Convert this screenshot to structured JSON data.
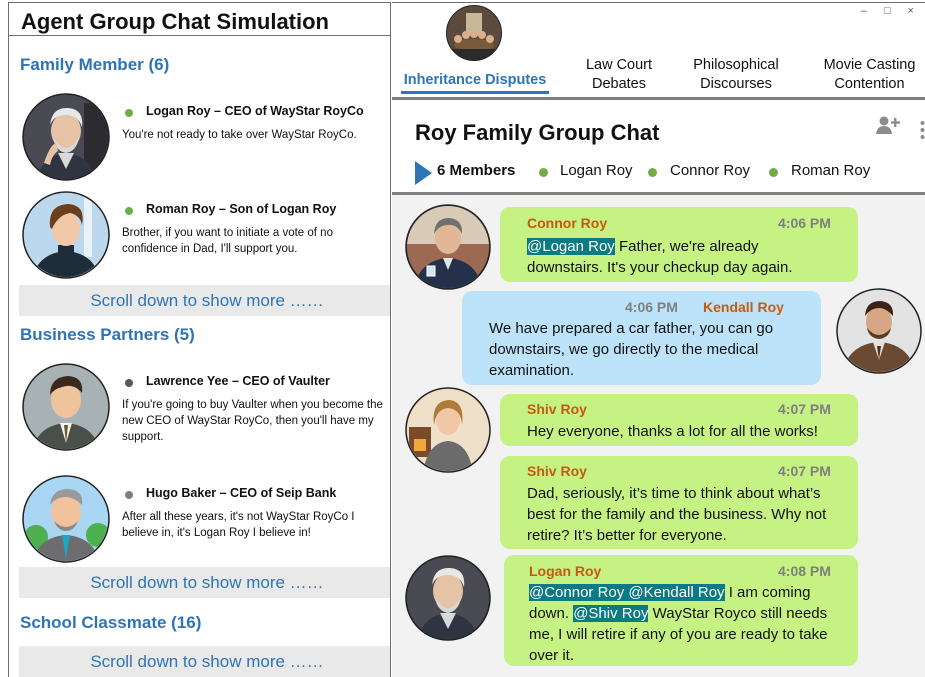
{
  "app": {
    "title": "Agent Group Chat Simulation"
  },
  "window_controls": "– □ ×",
  "groups": [
    {
      "title": "Family Member (6)",
      "members": [
        {
          "name": "Logan Roy – CEO of WayStar RoyCo",
          "message": "You're not ready to take over WayStar RoyCo.",
          "status_color": "#70ad47",
          "avatar": "elderly-man-avatar-icon"
        },
        {
          "name": "Roman Roy – Son of Logan Roy",
          "message": "Brother, if you want to initiate a vote of no confidence in Dad, I'll support you.",
          "status_color": "#70ad47",
          "avatar": "young-man-avatar-icon"
        }
      ],
      "scroll_label": "Scroll down to show more ……"
    },
    {
      "title": "Business Partners (5)",
      "members": [
        {
          "name": "Lawrence Yee – CEO of Vaulter",
          "message": "If you're going to buy Vaulter when you become the new CEO of WayStar RoyCo, then you'll have my support.",
          "status_color": "#595959",
          "avatar": "businessman-avatar-icon"
        },
        {
          "name": "Hugo Baker – CEO of Seip Bank",
          "message": "After all these years, it's not WayStar RoyCo I believe in, it's Logan Roy I believe in!",
          "status_color": "#7f7f7f",
          "avatar": "banker-avatar-icon"
        }
      ],
      "scroll_label": "Scroll down to show more ……"
    },
    {
      "title": "School Classmate (16)",
      "members": [],
      "scroll_label": "Scroll down to show more ……"
    }
  ],
  "tabs": [
    {
      "label": "Inheritance Disputes",
      "active": true
    },
    {
      "label": "Law Court Debates",
      "active": false
    },
    {
      "label": "Philosophical Discourses",
      "active": false
    },
    {
      "label": "Movie Casting Contention",
      "active": false
    }
  ],
  "chat": {
    "title": "Roy Family Group Chat",
    "members_count": "6 Members",
    "members": [
      "Logan Roy",
      "Connor Roy",
      "Roman Roy"
    ],
    "messages": [
      {
        "sender": "Connor Roy",
        "time": "4:06 PM",
        "mention": "@Logan Roy",
        "text": " Father, we're already downstairs. It's your checkup day again.",
        "side": "left",
        "color": "green"
      },
      {
        "sender": "Kendall Roy",
        "time": "4:06 PM",
        "text": "We have prepared a car father, you can go downstairs, we go directly to the medical examination.",
        "side": "right",
        "color": "blue"
      },
      {
        "sender": "Shiv Roy",
        "time": "4:07 PM",
        "text": "Hey everyone, thanks a lot for all the works!",
        "side": "left",
        "color": "green"
      },
      {
        "sender": "Shiv Roy",
        "time": "4:07 PM",
        "text": "Dad, seriously, it’s time to think about what’s best for the family and the business. Why not retire? It’s better for everyone.",
        "side": "left",
        "color": "green"
      },
      {
        "sender": "Logan Roy",
        "time": "4:08 PM",
        "mention1": "@Connor Roy @Kendall Roy",
        "text1": " I am coming down. ",
        "mention2": "@Shiv Roy",
        "text2": " WayStar Royco still needs me, I will retire if any of you are ready to take over it.",
        "side": "left",
        "color": "green"
      }
    ]
  }
}
